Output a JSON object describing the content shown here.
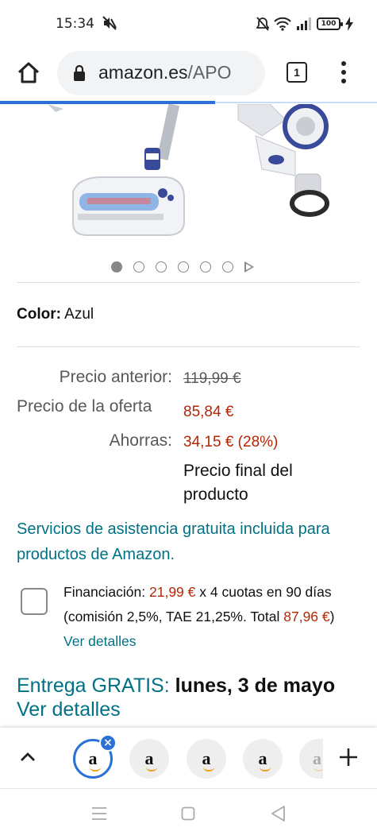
{
  "status_bar": {
    "time": "15:34",
    "battery": "100",
    "icons": [
      "mute-icon",
      "alarm-off-icon",
      "wifi-icon",
      "signal-icon",
      "battery-icon",
      "charging-icon"
    ]
  },
  "browser": {
    "url_main": "amazon.es",
    "url_path": "/APO",
    "tab_count": "1",
    "load_progress": 0.57
  },
  "carousel": {
    "dots": 6,
    "active_index": 0
  },
  "product": {
    "color_label": "Color:",
    "color_value": "Azul",
    "prev_price_label": "Precio anterior:",
    "prev_price": "119,99 €",
    "offer_price_label": "Precio de la oferta",
    "offer_price": "85,84 €",
    "savings_label": "Ahorras:",
    "savings": "34,15 € (28%)",
    "final_note": "Precio final del producto",
    "services_link": "Servicios de asistencia gratuita incluida para productos de Amazon.",
    "financing": {
      "prefix": "Financiación:",
      "installment": "21,99 €",
      "middle": "x 4 cuotas en 90 días (comisión 2,5%, TAE 21,25%. Total",
      "total": "87,96 €",
      "close": ")",
      "link": "Ver detalles"
    },
    "delivery": {
      "prefix": "Entrega GRATIS:",
      "date": "lunes, 3 de mayo",
      "link": "Ver detalles"
    }
  },
  "tab_strip": {
    "tabs": [
      {
        "label": "a",
        "active": true
      },
      {
        "label": "a",
        "active": false
      },
      {
        "label": "a",
        "active": false
      },
      {
        "label": "a",
        "active": false
      },
      {
        "label": "a",
        "active": false
      }
    ],
    "close_badge": "×"
  },
  "colors": {
    "link_teal": "#007185",
    "price_red": "#b12704",
    "accent_blue": "#2a70d6"
  }
}
